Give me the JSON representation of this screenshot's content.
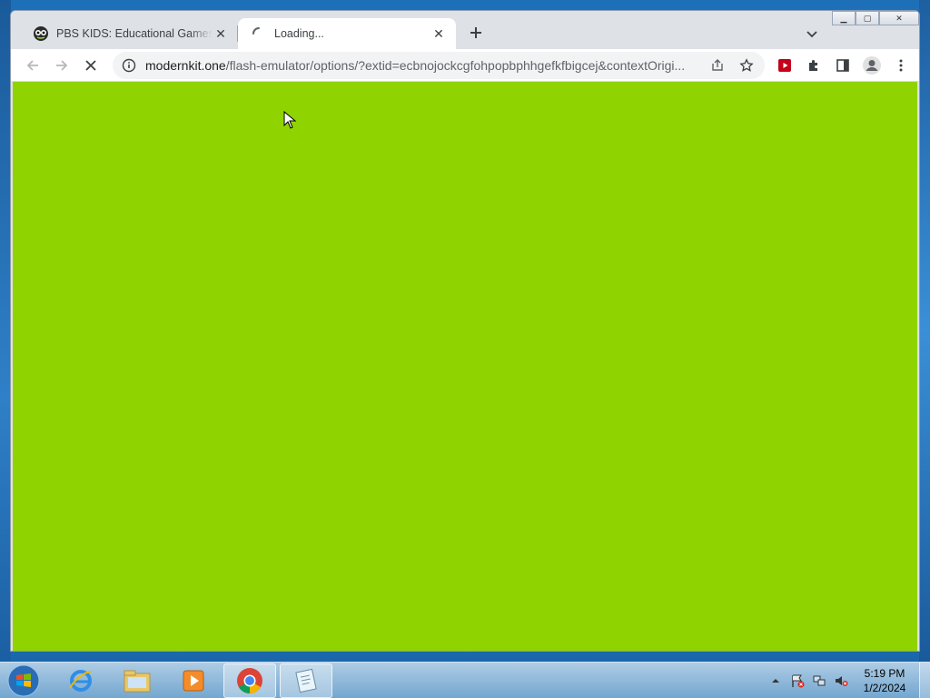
{
  "browser": {
    "tabs": [
      {
        "title": "PBS KIDS: Educational Games, Videos",
        "favicon": "pbs-kids-icon",
        "active": false
      },
      {
        "title": "Loading...",
        "favicon": "loading-spinner-icon",
        "active": true
      }
    ],
    "address": {
      "host": "modernkit.one",
      "path": "/flash-emulator/options/?extid=ecbnojockcgfohpopbphhgefkfbigcej&contextOrigi..."
    },
    "content_color": "#8fd400"
  },
  "taskbar": {
    "apps": [
      "internet-explorer-icon",
      "windows-explorer-icon",
      "media-player-icon",
      "chrome-icon",
      "notepad-icon"
    ],
    "clock": {
      "time": "5:19 PM",
      "date": "1/2/2024"
    }
  }
}
